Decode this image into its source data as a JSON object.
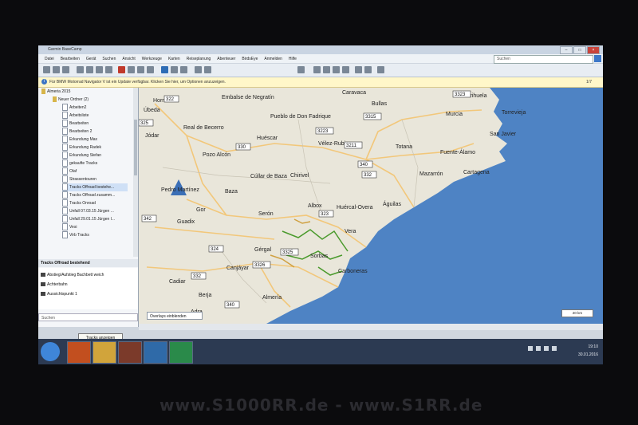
{
  "window": {
    "title": "Garmin BaseCamp"
  },
  "menu": [
    "Datei",
    "Bearbeiten",
    "Gerät",
    "Suchen",
    "Ansicht",
    "Werkzeuge",
    "Karten",
    "Reiseplanung",
    "Abenteuer",
    "BirdsEye",
    "Anmelden",
    "Hilfe"
  ],
  "search": {
    "placeholder": "Suchen"
  },
  "toolbar": {
    "map_product": "City Navigator Europe NTU 2016.3",
    "detail": "Mittel"
  },
  "infobar": {
    "text": "Für BMW Motorrad Navigator V ist ein Update verfügbar. Klicken Sie hier, um Optionen anzuzeigen.",
    "page": "1/7"
  },
  "tree": {
    "root": "Almeria 2015",
    "folder": "Neuer Ordner (2)",
    "items": [
      "Arbeiten2",
      "Arbeitsliste",
      "Bearbeiten",
      "Bearbeiten 2",
      "Erkundung Max",
      "Erkundung Radek",
      "Erkundung Stefan",
      "gekaufte Tracks",
      "Olaf",
      "Strassentouren",
      "Tracks Offroad bestehe...",
      "Tracks Offroad zusamm...",
      "Tracks Onroad",
      "Unfall 07.03.15 Jürgen ...",
      "Unfall 29.01.15 Jürgen l...",
      "Vesi",
      "Virb Tracks"
    ]
  },
  "subpanel": {
    "header": "Tracks Offroad bestehend",
    "items": [
      "Abstieg/Aufstieg Bachbett weich",
      "Achterbahn",
      "Aussichtspunkt 1"
    ]
  },
  "sidebar_search": {
    "placeholder": "Suchen"
  },
  "bottom": {
    "tooltip": "Tracks anzeigen"
  },
  "map": {
    "towns": [
      "Caravaca",
      "Bullas",
      "Orihuela",
      "Murcia",
      "Torrevieja",
      "San Javier",
      "Fuente-Álamo",
      "Cartagena",
      "Mazarrón",
      "Totana",
      "Pueblo de Don Fadrique",
      "Huéscar",
      "Vélez-Rubio",
      "Chirivel",
      "Cúllar de Baza",
      "Pozo Alcón",
      "Baza",
      "Pedro Martínez",
      "Gor",
      "Guadix",
      "Serón",
      "Albox",
      "Huércal-Overa",
      "Águilas",
      "Vera",
      "Gérgal",
      "Sorbas",
      "Carboneras",
      "Canjáyar",
      "Berja",
      "Adra",
      "Almería",
      "Cadiar",
      "Hornos",
      "Embalse de Negratín",
      "Úbeda",
      "Jódar",
      "Real de Becerro"
    ],
    "roads": [
      "322",
      "325",
      "330",
      "3211",
      "3315",
      "3323",
      "3223",
      "332",
      "340",
      "342",
      "323",
      "324",
      "3326",
      "3325",
      "332",
      "340"
    ],
    "overlay_button": "Overlays einblenden",
    "scale": "20 km"
  },
  "taskbar": {
    "time": "19:10",
    "date": "30.01.2016",
    "lang": "DE"
  },
  "watermark": "www.S1000RR.de - www.S1RR.de",
  "colors": {
    "sea": "#4e83c4",
    "land": "#e9e6da",
    "road": "#f2c77a",
    "track": "#4a9a2c"
  }
}
